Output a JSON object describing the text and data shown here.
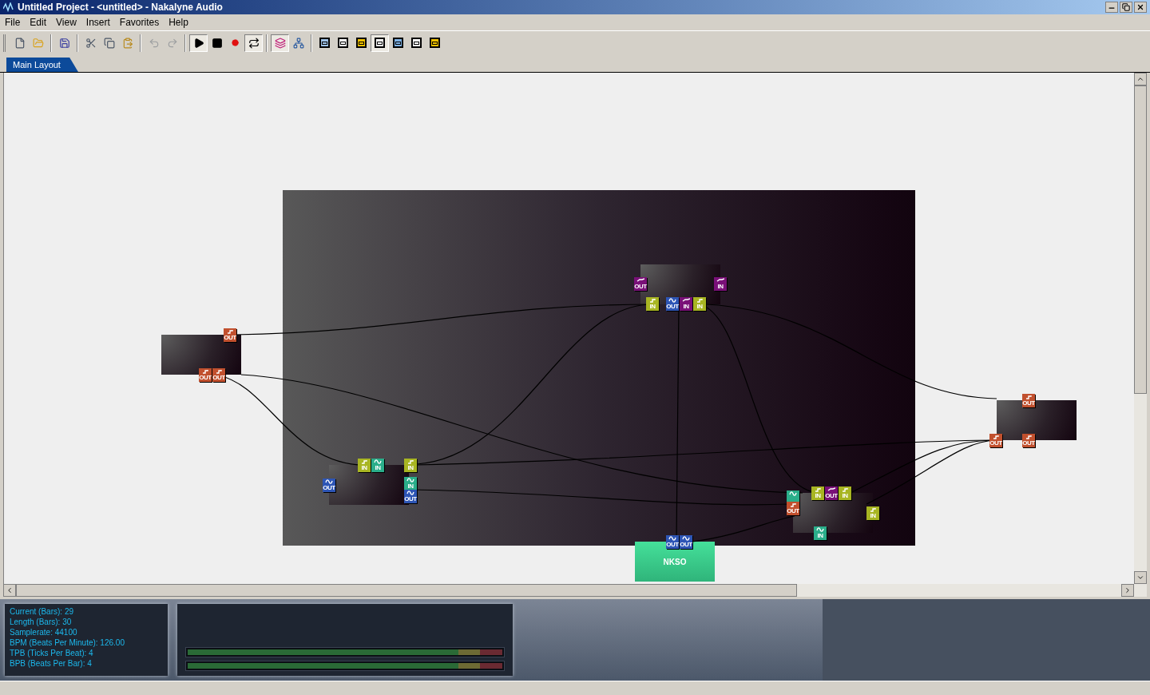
{
  "window": {
    "title": "Untitled Project - <untitled> - Nakalyne Audio"
  },
  "menu": [
    "File",
    "Edit",
    "View",
    "Insert",
    "Favorites",
    "Help"
  ],
  "toolbar": [
    [
      {
        "kind": "new",
        "pressed": false,
        "disabled": false
      },
      {
        "kind": "open",
        "pressed": false,
        "disabled": false
      }
    ],
    [
      {
        "kind": "save",
        "pressed": false,
        "disabled": false
      }
    ],
    [
      {
        "kind": "cut",
        "pressed": false,
        "disabled": false
      },
      {
        "kind": "copy",
        "pressed": false,
        "disabled": false
      },
      {
        "kind": "paste",
        "pressed": false,
        "disabled": false
      }
    ],
    [
      {
        "kind": "undo",
        "pressed": false,
        "disabled": true
      },
      {
        "kind": "redo",
        "pressed": false,
        "disabled": true
      }
    ],
    [
      {
        "kind": "play",
        "pressed": true,
        "disabled": false
      },
      {
        "kind": "stop",
        "pressed": false,
        "disabled": false
      },
      {
        "kind": "record",
        "pressed": false,
        "disabled": false
      },
      {
        "kind": "loop",
        "pressed": true,
        "disabled": false
      }
    ],
    [
      {
        "kind": "layers",
        "pressed": true,
        "disabled": false
      },
      {
        "kind": "routing",
        "pressed": false,
        "disabled": false
      }
    ],
    [
      {
        "kind": "view",
        "color": "#9fc3e8",
        "pressed": false,
        "disabled": false
      },
      {
        "kind": "view",
        "color": "#ffffff",
        "pressed": false,
        "disabled": false
      },
      {
        "kind": "view",
        "color": "#f2c200",
        "pressed": false,
        "disabled": false
      },
      {
        "kind": "view",
        "color": "#ffffff",
        "pressed": true,
        "disabled": false
      },
      {
        "kind": "view",
        "color": "#7fb2e5",
        "pressed": false,
        "disabled": false
      },
      {
        "kind": "view",
        "color": "#ffffff",
        "pressed": false,
        "disabled": false
      },
      {
        "kind": "view",
        "color": "#f2c200",
        "pressed": false,
        "disabled": false
      }
    ]
  ],
  "tabs": [
    {
      "label": "Main Layout",
      "selected": true
    }
  ],
  "nodes": [
    {
      "kind": "module",
      "ports": [
        {
          "kind": "note",
          "label": "OUT",
          "color": "#c1502e"
        },
        {
          "kind": "note",
          "label": "OUT",
          "color": "#c1502e"
        },
        {
          "kind": "note",
          "label": "OUT",
          "color": "#c1502e"
        }
      ]
    },
    {
      "kind": "module",
      "ports": [
        {
          "kind": "note",
          "label": "IN",
          "color": "#a8b522"
        },
        {
          "kind": "wave",
          "label": "IN",
          "color": "#2aae8a"
        },
        {
          "kind": "note",
          "label": "IN",
          "color": "#a8b522"
        },
        {
          "kind": "wave",
          "label": "OUT",
          "color": "#2d55b5"
        },
        {
          "kind": "wave",
          "label": "IN",
          "color": "#2aae8a"
        },
        {
          "kind": "wave",
          "label": "OUT",
          "color": "#2d55b5"
        }
      ]
    },
    {
      "kind": "module",
      "ports": [
        {
          "kind": "automation",
          "label": "OUT",
          "color": "#7a1078"
        },
        {
          "kind": "automation",
          "label": "IN",
          "color": "#7a1078"
        },
        {
          "kind": "note",
          "label": "IN",
          "color": "#a8b522"
        },
        {
          "kind": "wave",
          "label": "OUT",
          "color": "#2d55b5"
        },
        {
          "kind": "automation",
          "label": "IN",
          "color": "#7a1078"
        },
        {
          "kind": "note",
          "label": "IN",
          "color": "#a8b522"
        }
      ]
    },
    {
      "kind": "module",
      "ports": [
        {
          "kind": "note",
          "label": "IN",
          "color": "#a8b522"
        },
        {
          "kind": "automation",
          "label": "OUT",
          "color": "#7a1078"
        },
        {
          "kind": "note",
          "label": "IN",
          "color": "#a8b522"
        },
        {
          "kind": "wave",
          "color": "#2aae8a"
        },
        {
          "kind": "note",
          "label": "OUT",
          "color": "#c1502e"
        },
        {
          "kind": "note",
          "label": "IN",
          "color": "#a8b522"
        },
        {
          "kind": "wave",
          "label": "IN",
          "color": "#2aae8a"
        }
      ]
    },
    {
      "kind": "module",
      "ports": [
        {
          "kind": "note",
          "label": "OUT",
          "color": "#c1502e"
        },
        {
          "kind": "note",
          "label": "OUT",
          "color": "#c1502e"
        },
        {
          "kind": "note",
          "label": "OUT",
          "color": "#c1502e"
        }
      ]
    },
    {
      "kind": "output",
      "label": "NKSO",
      "ports": [
        {
          "kind": "wave",
          "label": "OUT",
          "color": "#2d55b5"
        },
        {
          "kind": "wave",
          "label": "OUT",
          "color": "#2d55b5"
        }
      ]
    }
  ],
  "info": [
    "Current (Bars): 29",
    "Length (Bars): 30",
    "Samplerate: 44100",
    "BPM (Beats Per Minute): 126.00",
    "TPB (Ticks Per Beat): 4",
    "BPB (Beats Per Bar): 4"
  ],
  "meters": [
    {
      "level": 1
    },
    {
      "level": 1
    }
  ]
}
